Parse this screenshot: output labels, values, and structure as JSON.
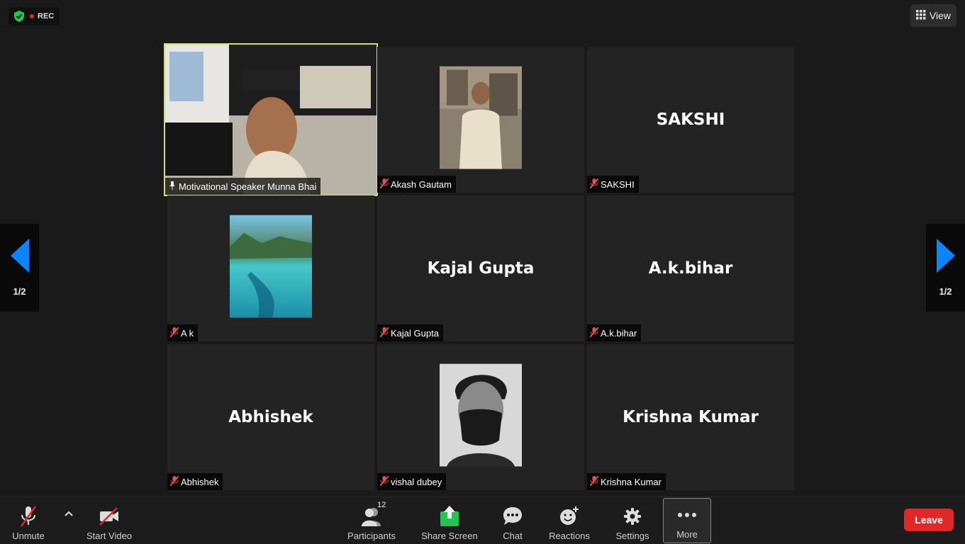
{
  "status": {
    "rec_label": "REC"
  },
  "view_button": {
    "label": "View"
  },
  "pager": {
    "left_page": "1/2",
    "right_page": "1/2"
  },
  "participants": [
    {
      "tile_name": "",
      "label": "Motivational Speaker Munna Bhai",
      "pinned": true
    },
    {
      "tile_name": "",
      "label": "Akash Gautam",
      "pinned": false
    },
    {
      "tile_name": "SAKSHI",
      "label": "SAKSHI",
      "pinned": false
    },
    {
      "tile_name": "",
      "label": "A k",
      "pinned": false
    },
    {
      "tile_name": "Kajal Gupta",
      "label": "Kajal Gupta",
      "pinned": false
    },
    {
      "tile_name": "A.k.bihar",
      "label": "A.k.bihar",
      "pinned": false
    },
    {
      "tile_name": "Abhishek",
      "label": "Abhishek",
      "pinned": false
    },
    {
      "tile_name": "",
      "label": "vishal dubey",
      "pinned": false
    },
    {
      "tile_name": "Krishna Kumar",
      "label": "Krishna Kumar",
      "pinned": false
    }
  ],
  "toolbar": {
    "unmute": "Unmute",
    "start_video": "Start Video",
    "participants": "Participants",
    "participants_count": "12",
    "share_screen": "Share Screen",
    "chat": "Chat",
    "reactions": "Reactions",
    "settings": "Settings",
    "more": "More",
    "leave": "Leave"
  },
  "colors": {
    "active_speaker_border": "#c5e26a",
    "leave_red": "#e02828",
    "share_green": "#23c552",
    "nav_blue": "#0b84ff"
  }
}
